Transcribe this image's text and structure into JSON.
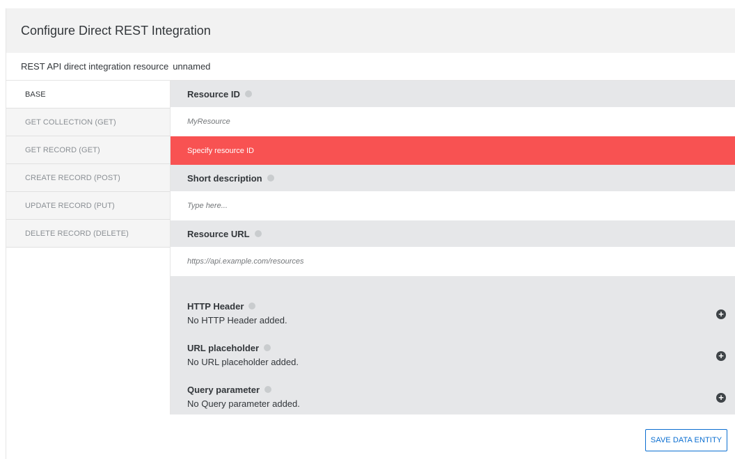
{
  "dialog": {
    "title": "Configure Direct REST Integration",
    "subheader_label": "REST API direct integration resource",
    "subheader_value": "unnamed"
  },
  "sidebar": {
    "items": [
      {
        "label": "BASE",
        "active": true
      },
      {
        "label": "GET COLLECTION (GET)",
        "active": false
      },
      {
        "label": "GET RECORD (GET)",
        "active": false
      },
      {
        "label": "CREATE RECORD (POST)",
        "active": false
      },
      {
        "label": "UPDATE RECORD (PUT)",
        "active": false
      },
      {
        "label": "DELETE RECORD (DELETE)",
        "active": false
      }
    ]
  },
  "form": {
    "resource_id": {
      "label": "Resource ID",
      "placeholder": "MyResource",
      "error": "Specify resource ID"
    },
    "short_description": {
      "label": "Short description",
      "placeholder": "Type here..."
    },
    "resource_url": {
      "label": "Resource URL",
      "placeholder": "https://api.example.com/resources"
    },
    "http_header": {
      "label": "HTTP Header",
      "empty": "No HTTP Header added."
    },
    "url_placeholder": {
      "label": "URL placeholder",
      "empty": "No URL placeholder added."
    },
    "query_parameter": {
      "label": "Query parameter",
      "empty": "No Query parameter added."
    }
  },
  "footer": {
    "save_label": "SAVE DATA ENTITY"
  },
  "icons": {
    "info": "info-icon",
    "add": "plus-circle-icon"
  },
  "colors": {
    "error": "#f85252",
    "accent": "#0a6ed1",
    "panel": "#e6e7e9"
  }
}
